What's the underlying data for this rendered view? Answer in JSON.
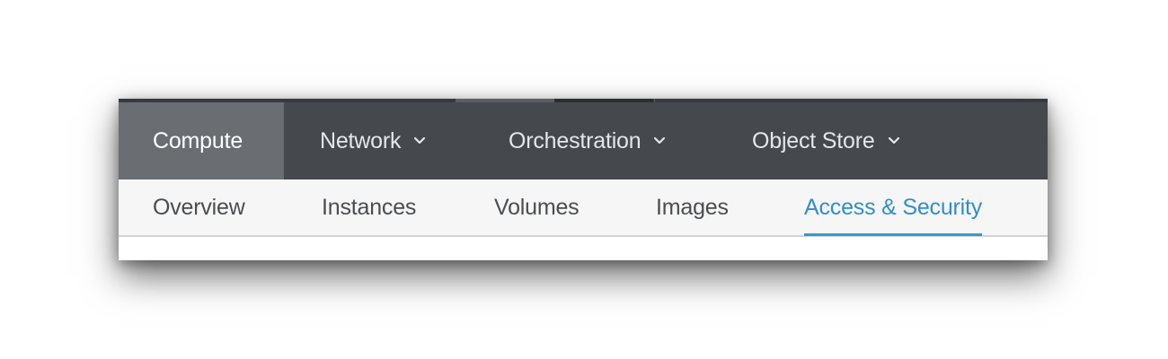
{
  "primary_nav": {
    "items": [
      {
        "label": "Compute",
        "active": true,
        "has_dropdown": false
      },
      {
        "label": "Network",
        "active": false,
        "has_dropdown": true
      },
      {
        "label": "Orchestration",
        "active": false,
        "has_dropdown": true
      },
      {
        "label": "Object Store",
        "active": false,
        "has_dropdown": true
      }
    ],
    "dropdown_icon": "chevron-down-icon"
  },
  "secondary_nav": {
    "items": [
      {
        "label": "Overview",
        "active": false
      },
      {
        "label": "Instances",
        "active": false
      },
      {
        "label": "Volumes",
        "active": false
      },
      {
        "label": "Images",
        "active": false
      },
      {
        "label": "Access & Security",
        "active": true
      }
    ]
  },
  "colors": {
    "primary_nav_bg": "#45494d",
    "primary_active_bg": "#6a6e73",
    "secondary_nav_bg": "#f6f6f6",
    "accent": "#2f8fc9"
  }
}
